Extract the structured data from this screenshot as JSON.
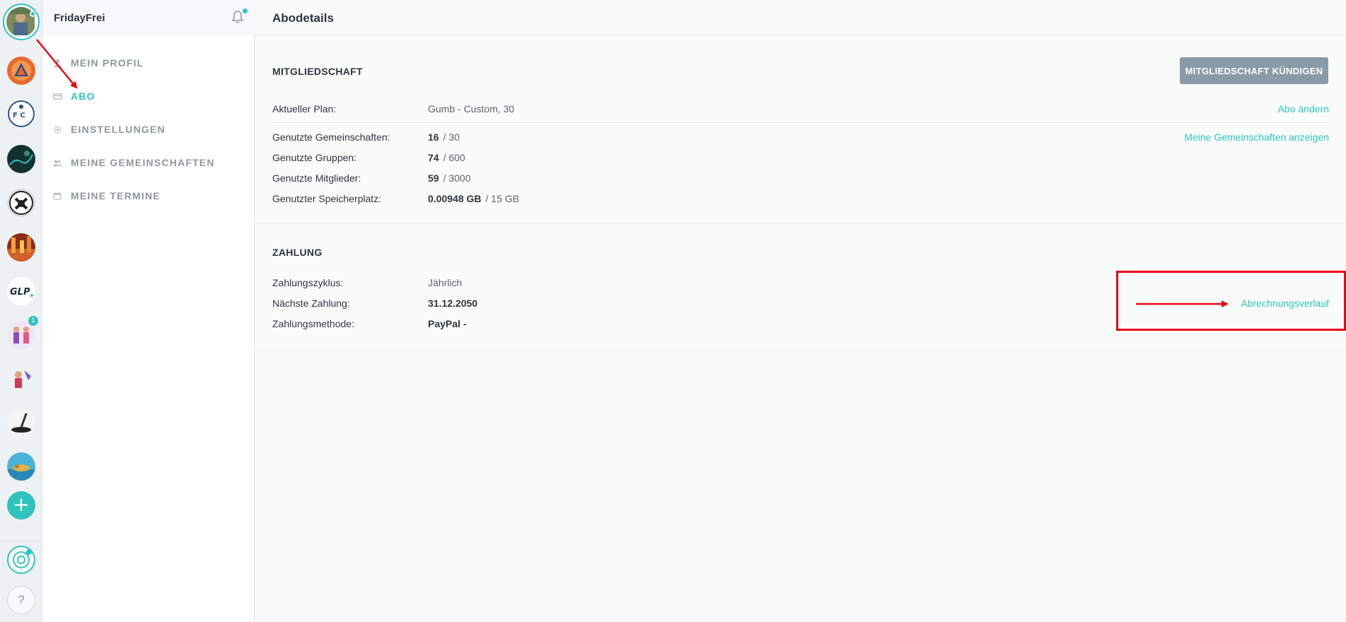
{
  "user": {
    "name": "FridayFrei"
  },
  "menu": {
    "items": [
      {
        "label": "MEIN PROFIL",
        "icon": "user-icon",
        "active": false
      },
      {
        "label": "ABO",
        "icon": "credit-card-icon",
        "active": true
      },
      {
        "label": "EINSTELLUNGEN",
        "icon": "gear-icon",
        "active": false
      },
      {
        "label": "MEINE GEMEINSCHAFTEN",
        "icon": "group-icon",
        "active": false
      },
      {
        "label": "MEINE TERMINE",
        "icon": "calendar-icon",
        "active": false
      }
    ]
  },
  "rail": {
    "badge_count": "1",
    "plus": "+",
    "help": "?"
  },
  "page": {
    "title": "Abodetails"
  },
  "membership": {
    "title": "MITGLIEDSCHAFT",
    "cancel_button": "MITGLIEDSCHAFT KÜNDIGEN",
    "plan_label": "Aktueller Plan:",
    "plan_value": "Gumb - Custom, 30",
    "change_link": "Abo ändern",
    "communities_link": "Meine Gemeinschaften anzeigen",
    "usage": [
      {
        "label": "Genutzte Gemeinschaften:",
        "used": "16",
        "limit": "/ 30"
      },
      {
        "label": "Genutzte Gruppen:",
        "used": "74",
        "limit": "/ 600"
      },
      {
        "label": "Genutzte Mitglieder:",
        "used": "59",
        "limit": "/ 3000"
      },
      {
        "label": "Genutzter Speicherplatz:",
        "used": "0.00948 GB",
        "limit": "/ 15 GB"
      }
    ]
  },
  "payment": {
    "title": "ZAHLUNG",
    "cycle_label": "Zahlungszyklus:",
    "cycle_value": "Jährlich",
    "next_label": "Nächste Zahlung:",
    "next_value": "31.12.2050",
    "method_label": "Zahlungsmethode:",
    "method_value": "PayPal -",
    "history_link": "Abrechnungsverlauf"
  },
  "colors": {
    "accent": "#2ec4bd",
    "annotation": "#e8060e",
    "button": "#8a9aa8"
  }
}
